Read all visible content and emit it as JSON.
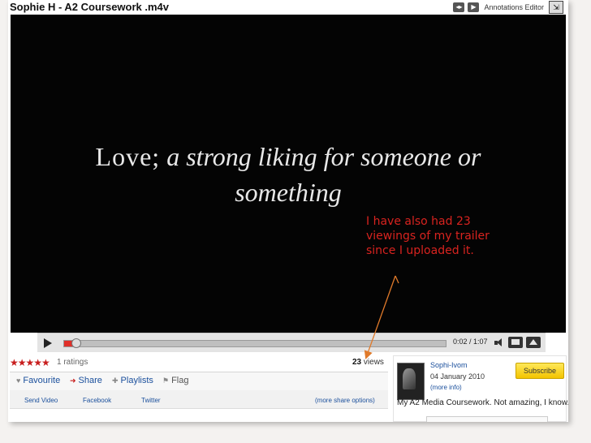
{
  "window": {
    "title": "Sophie H - A2 Coursework .m4v",
    "annotations_label": "Annotations Editor"
  },
  "video": {
    "quote_line1_roman": "Love;",
    "quote_line1_italic": " a strong liking for someone or",
    "quote_line2": "something",
    "annotation_text": "I have also had 23 viewings of my trailer since I uploaded it.",
    "annotation_color": "#d8231f"
  },
  "player": {
    "time": "0:02 / 1:07",
    "progress_fraction": 0.03
  },
  "stats": {
    "stars": "★★★★★",
    "ratings": "1 ratings",
    "views_count": "23",
    "views_label": "views"
  },
  "actions": {
    "favourite": "Favourite",
    "share": "Share",
    "playlists": "Playlists",
    "flag": "Flag"
  },
  "share_links": {
    "send_video": "Send Video",
    "facebook": "Facebook",
    "twitter": "Twitter",
    "more": "(more share options)"
  },
  "channel": {
    "username": "Sophi-Ivom",
    "date": "04 January 2010",
    "more_info": "(more info)",
    "subscribe": "Subscribe",
    "description": "My A2 Media Coursework. Not amazing, I know."
  },
  "colors": {
    "accent_red": "#c81e1e",
    "link_blue": "#1a4f9c",
    "subscribe_yellow": "#f3c400"
  }
}
